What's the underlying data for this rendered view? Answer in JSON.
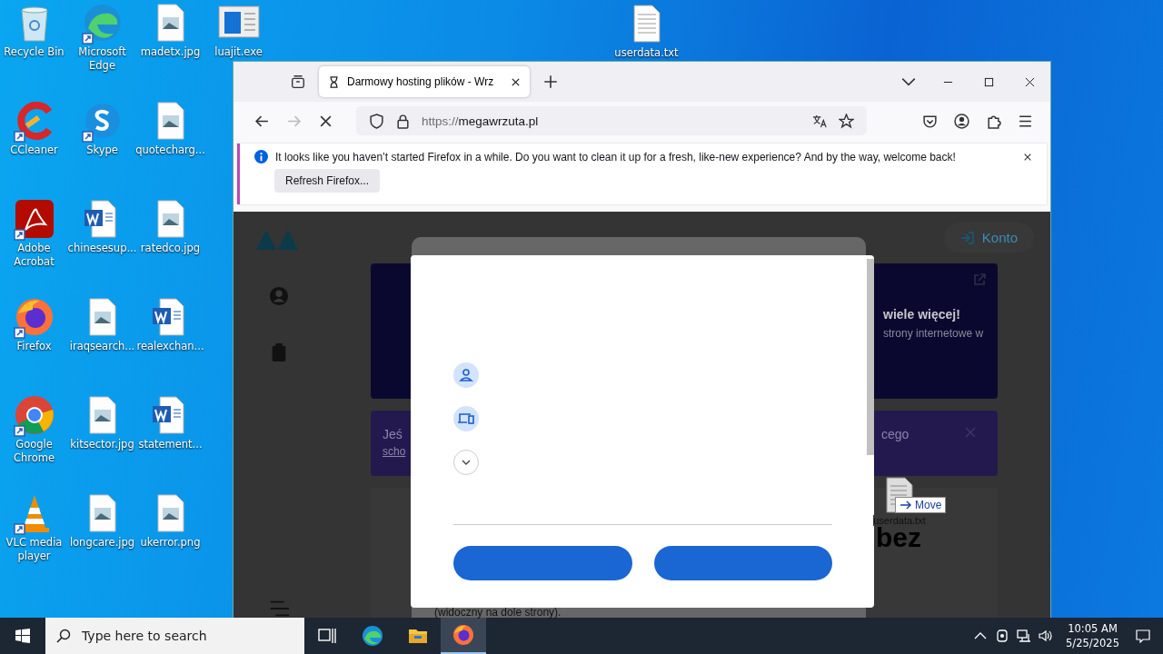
{
  "desktop": {
    "icons": [
      {
        "label": "Recycle Bin",
        "kind": "recycle",
        "shortcut": false
      },
      {
        "label": "CCleaner",
        "kind": "ccleaner",
        "shortcut": true
      },
      {
        "label": "Adobe Acrobat",
        "kind": "acrobat",
        "shortcut": true
      },
      {
        "label": "Firefox",
        "kind": "firefox",
        "shortcut": true
      },
      {
        "label": "Google Chrome",
        "kind": "chrome",
        "shortcut": true
      },
      {
        "label": "VLC media player",
        "kind": "vlc",
        "shortcut": true
      },
      {
        "label": "Microsoft Edge",
        "kind": "edge",
        "shortcut": true
      },
      {
        "label": "Skype",
        "kind": "skype",
        "shortcut": true
      },
      {
        "label": "chinesesup...",
        "kind": "word",
        "shortcut": false
      },
      {
        "label": "iraqsearch...",
        "kind": "image",
        "shortcut": false
      },
      {
        "label": "kitsector.jpg",
        "kind": "image",
        "shortcut": false
      },
      {
        "label": "longcare.jpg",
        "kind": "image",
        "shortcut": false
      },
      {
        "label": "madetx.jpg",
        "kind": "image",
        "shortcut": false
      },
      {
        "label": "quotecharg...",
        "kind": "image",
        "shortcut": false
      },
      {
        "label": "ratedco.jpg",
        "kind": "image",
        "shortcut": false
      },
      {
        "label": "realexchan...",
        "kind": "word",
        "shortcut": false
      },
      {
        "label": "statement...",
        "kind": "word",
        "shortcut": false
      },
      {
        "label": "ukerror.png",
        "kind": "image",
        "shortcut": false
      },
      {
        "label": "luajit.exe",
        "kind": "exe",
        "shortcut": false
      }
    ],
    "loose_icon": {
      "label": "userdata.txt",
      "kind": "text"
    }
  },
  "browser": {
    "tabs": [
      {
        "title": "Darmowy hosting plików - Wrz",
        "selected": true
      }
    ],
    "url": {
      "scheme": "https://",
      "host": "megawrzuta.pl"
    },
    "notification": {
      "message": "It looks like you haven’t started Firefox in a while. Do you want to clean it up for a fresh, like-new experience? And by the way, welcome back!",
      "button": "Refresh Firefox..."
    },
    "page": {
      "account_button": "Konto",
      "banner_heading": "wiele więcej!",
      "banner_text": "strony internetowe w",
      "notice_start": "Jeś",
      "notice_link": "scho",
      "notice_end": "cego",
      "card_word": "bez",
      "footnote": "(widoczny na dole strony)."
    },
    "dialog": {
      "rows": [
        {
          "kind": "person"
        },
        {
          "kind": "devices"
        },
        {
          "kind": "expand"
        }
      ],
      "buttons": [
        {
          "kind": "primary"
        },
        {
          "kind": "primary"
        }
      ]
    },
    "drag": {
      "file": "userdata.txt",
      "action": "Move"
    }
  },
  "taskbar": {
    "search_placeholder": "Type here to search",
    "apps": [
      {
        "kind": "taskview",
        "active": false
      },
      {
        "kind": "edge",
        "active": false
      },
      {
        "kind": "explorer",
        "active": false
      },
      {
        "kind": "firefox",
        "active": true
      }
    ],
    "time": "10:05 AM",
    "date": "5/25/2025"
  }
}
